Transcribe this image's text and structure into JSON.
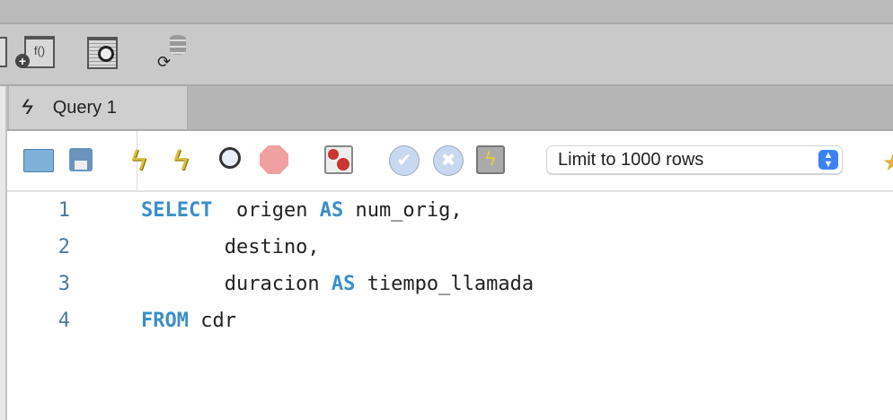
{
  "tab": {
    "label": "Query 1",
    "icon": "lightning-icon"
  },
  "toolbar": {
    "limit_select": "Limit to 1000 rows"
  },
  "editor": {
    "lines": [
      {
        "num": "1",
        "tokens": [
          {
            "t": "SELECT",
            "kw": true
          },
          {
            "t": "  origen "
          },
          {
            "t": "AS",
            "kw": true
          },
          {
            "t": " num_orig,"
          }
        ]
      },
      {
        "num": "2",
        "tokens": [
          {
            "t": "       destino,"
          }
        ]
      },
      {
        "num": "3",
        "tokens": [
          {
            "t": "       duracion "
          },
          {
            "t": "AS",
            "kw": true
          },
          {
            "t": " tiempo_llamada"
          }
        ]
      },
      {
        "num": "4",
        "tokens": [
          {
            "t": "FROM",
            "kw": true
          },
          {
            "t": " cdr"
          }
        ]
      }
    ]
  },
  "colors": {
    "keyword": "#3a8fc8",
    "line_number": "#4a7a9a",
    "select_stepper": "#3b82f6"
  }
}
